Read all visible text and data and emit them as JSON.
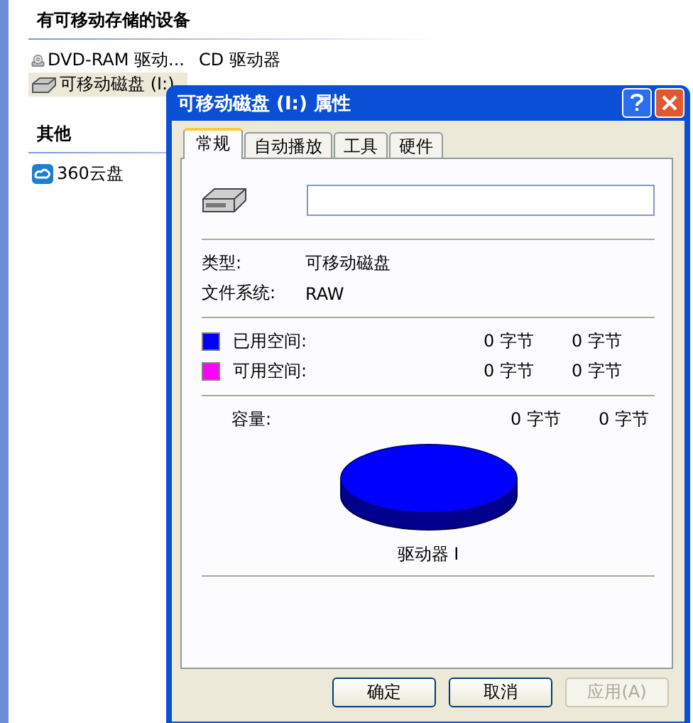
{
  "explorer": {
    "groups": [
      {
        "title": "有可移动存储的设备",
        "items": [
          {
            "name": "DVD-RAM 驱动...",
            "kind": "dvd",
            "type": "CD 驱动器",
            "selected": false
          },
          {
            "name": "可移动磁盘 (I:)",
            "kind": "removable",
            "selected": true
          }
        ]
      },
      {
        "title": "其他",
        "items": [
          {
            "name": "360云盘",
            "kind": "cloud",
            "selected": false
          }
        ]
      }
    ]
  },
  "dialog": {
    "title": "可移动磁盘 (I:) 属性",
    "tabs": [
      {
        "label": "常规",
        "selected": true
      },
      {
        "label": "自动播放",
        "selected": false
      },
      {
        "label": "工具",
        "selected": false
      },
      {
        "label": "硬件",
        "selected": false
      }
    ],
    "fields": [
      {
        "label": "类型:",
        "value": "可移动磁盘"
      },
      {
        "label": "文件系统:",
        "value": "RAW"
      }
    ],
    "space": [
      {
        "label": "已用空间:",
        "color": "#0000ff",
        "bytes": "0 字节",
        "size": "0 字节"
      },
      {
        "label": "可用空间:",
        "color": "#ff00ff",
        "bytes": "0 字节",
        "size": "0 字节"
      }
    ],
    "capacity": {
      "label": "容量:",
      "bytes": "0 字节",
      "size": "0 字节"
    },
    "drive_label": "驱动器 I",
    "buttons": [
      {
        "label": "确定",
        "disabled": false
      },
      {
        "label": "取消",
        "disabled": false
      },
      {
        "label": "应用(A)",
        "disabled": true
      }
    ]
  }
}
